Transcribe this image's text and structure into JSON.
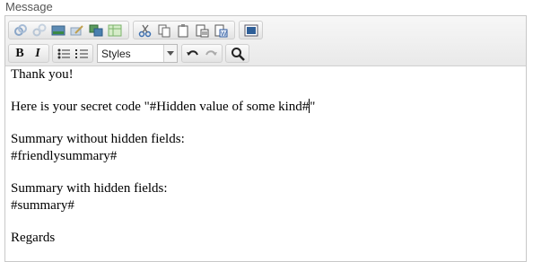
{
  "field_label": "Message",
  "toolbar": {
    "row1_group1_icons": [
      "link-icon",
      "unlink-icon",
      "image-icon",
      "edit-image-icon",
      "insert-media-icon",
      "table-icon"
    ],
    "row1_group2_icons": [
      "cut-icon",
      "copy-icon",
      "paste-icon",
      "paste-text-icon",
      "paste-word-icon"
    ],
    "row1_group3_icons": [
      "source-icon"
    ],
    "row2_format_icons": [
      "bold-icon",
      "italic-icon"
    ],
    "row2_format_labels": [
      "B",
      "I"
    ],
    "row2_list_icons": [
      "bulleted-list-icon",
      "numbered-list-icon"
    ],
    "styles_select": {
      "value": "Styles"
    },
    "row2_history_icons": [
      "undo-icon",
      "redo-icon"
    ],
    "row2_find_icons": [
      "find-icon"
    ]
  },
  "content": {
    "greeting": "Thank you!",
    "secret_line": "Here is your secret code \"#Hidden value of some kind#",
    "secret_line_end": "\"",
    "summary_without_label": "Summary without hidden fields:",
    "summary_without_token": "#friendlysummary#",
    "summary_with_label": "Summary with hidden fields:",
    "summary_with_token": "#summary#",
    "closing": "Regards"
  }
}
